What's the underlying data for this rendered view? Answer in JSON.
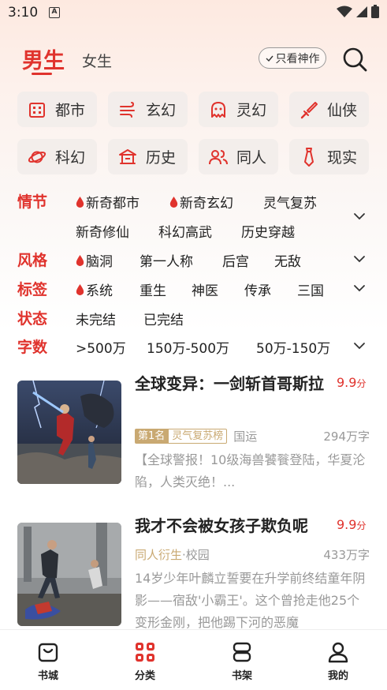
{
  "status": {
    "time": "3:10"
  },
  "header": {
    "tab_male": "男生",
    "tab_female": "女生",
    "only_god": "只看神作"
  },
  "categories": [
    {
      "label": "都市",
      "icon": "building-icon"
    },
    {
      "label": "玄幻",
      "icon": "wind-icon"
    },
    {
      "label": "灵幻",
      "icon": "ghost-icon"
    },
    {
      "label": "仙侠",
      "icon": "sword-icon"
    },
    {
      "label": "科幻",
      "icon": "planet-icon"
    },
    {
      "label": "历史",
      "icon": "temple-icon"
    },
    {
      "label": "同人",
      "icon": "people-icon"
    },
    {
      "label": "现实",
      "icon": "tie-icon"
    }
  ],
  "filters": {
    "plot": {
      "label": "情节",
      "options": [
        "新奇都市",
        "新奇玄幻",
        "灵气复苏",
        "新奇修仙",
        "科幻高武",
        "历史穿越"
      ]
    },
    "style": {
      "label": "风格",
      "options": [
        "脑洞",
        "第一人称",
        "后宫",
        "无敌"
      ]
    },
    "tags": {
      "label": "标签",
      "options": [
        "系统",
        "重生",
        "神医",
        "传承",
        "三国"
      ]
    },
    "status": {
      "label": "状态",
      "options": [
        "未完结",
        "已完结"
      ]
    },
    "words": {
      "label": "字数",
      "options": [
        ">500万",
        "150万-500万",
        "50万-150万"
      ]
    }
  },
  "books": [
    {
      "title": "全球变异：一剑斩首哥斯拉",
      "score": "9.9",
      "score_unit": "分",
      "rank": "第1名",
      "rank_list": "灵气复苏榜",
      "tag": "国运",
      "words": "294万字",
      "desc": "【全球警报！10级海兽饕餮登陆，华夏沦陷，人类灭绝！..."
    },
    {
      "title": "我才不会被女孩子欺负呢",
      "score": "9.9",
      "score_unit": "分",
      "genre": "同人衍生",
      "tag": "·校园",
      "words": "433万字",
      "desc": "14岁少年叶麟立誓要在升学前终结童年阴影——宿敌'小霸王'。这个曾抢走他25个变形金刚，把他踢下河的恶魔"
    }
  ],
  "nav": {
    "bookstore": "书城",
    "category": "分类",
    "shelf": "书架",
    "mine": "我的"
  },
  "colors": {
    "accent": "#e0332d",
    "gold": "#c9a972"
  }
}
